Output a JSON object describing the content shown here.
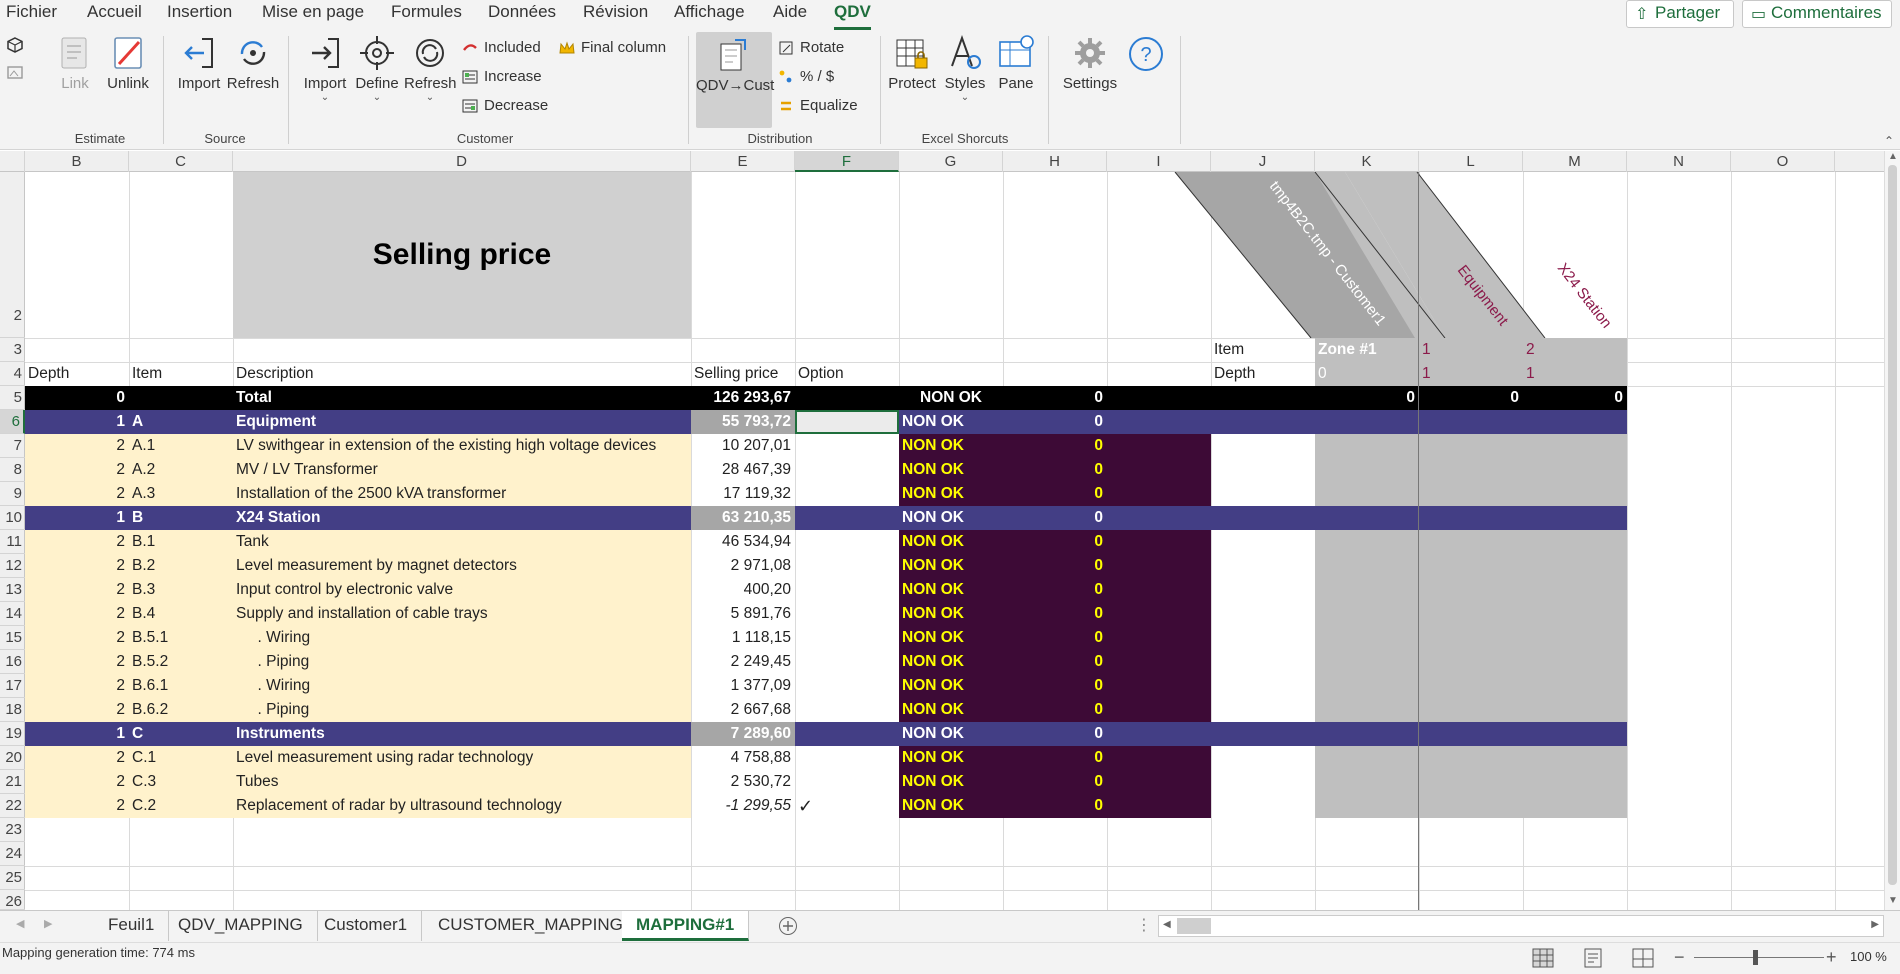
{
  "menu": {
    "items": [
      "Fichier",
      "Accueil",
      "Insertion",
      "Mise en page",
      "Formules",
      "Données",
      "Révision",
      "Affichage",
      "Aide",
      "QDV"
    ],
    "active": "QDV",
    "share_label": "Partager",
    "comments_label": "Commentaires"
  },
  "ribbon": {
    "estimate": {
      "label": "Estimate",
      "link": "Link",
      "unlink": "Unlink"
    },
    "source": {
      "label": "Source",
      "import": "Import",
      "refresh": "Refresh"
    },
    "customer": {
      "label": "Customer",
      "import": "Import",
      "define": "Define",
      "refresh": "Refresh",
      "included": "Included",
      "increase": "Increase",
      "decrease": "Decrease",
      "final_column": "Final column"
    },
    "distribution": {
      "label": "Distribution",
      "qdv_cust": "QDV→Cust",
      "rotate": "Rotate",
      "percent": "% / $",
      "equalize": "Equalize"
    },
    "excel": {
      "label": "Excel Shorcuts",
      "protect": "Protect",
      "styles": "Styles",
      "pane": "Pane"
    },
    "settings": {
      "label": "Settings"
    }
  },
  "columns": [
    "B",
    "C",
    "D",
    "E",
    "F",
    "G",
    "H",
    "I",
    "J",
    "K",
    "L",
    "M",
    "N",
    "O"
  ],
  "selected_column": "F",
  "rows_numbers": [
    "2",
    "3",
    "4",
    "5",
    "6",
    "7",
    "8",
    "9",
    "10",
    "11",
    "12",
    "13",
    "14",
    "15",
    "16",
    "17",
    "18",
    "19",
    "20",
    "21",
    "22",
    "23",
    "24",
    "25",
    "26"
  ],
  "selected_row": "6",
  "sheet": {
    "title": "Selling price",
    "rotated_headers": [
      "tmp4B2C.tmp - Customer1",
      "Equipment",
      "X24 Station"
    ],
    "row3": {
      "item_label": "Item",
      "zone": "Zone #1",
      "k1": "1",
      "k2": "2"
    },
    "row4": {
      "depth": "Depth",
      "item": "Item",
      "description": "Description",
      "selling_price": "Selling price",
      "option": "Option",
      "depth_label": "Depth",
      "d0": "0",
      "d1": "1",
      "d2": "1"
    },
    "total": {
      "depth": "0",
      "description": "Total",
      "price": "126 293,67",
      "status": "NON OK",
      "value": "0",
      "k": "0",
      "l": "0",
      "m": "0"
    },
    "lines": [
      {
        "depth": "1",
        "item": "A",
        "desc": "Equipment",
        "price": "55 793,72",
        "option": "",
        "status": "NON OK",
        "val": "0",
        "kind": "group"
      },
      {
        "depth": "2",
        "item": "A.1",
        "desc": "LV swithgear in extension of the existing high voltage devices",
        "price": "10 207,01",
        "option": "",
        "status": "NON OK",
        "val": "0",
        "kind": "line"
      },
      {
        "depth": "2",
        "item": "A.2",
        "desc": "MV / LV Transformer",
        "price": "28 467,39",
        "option": "",
        "status": "NON OK",
        "val": "0",
        "kind": "line"
      },
      {
        "depth": "2",
        "item": "A.3",
        "desc": "Installation of the 2500 kVA transformer",
        "price": "17 119,32",
        "option": "",
        "status": "NON OK",
        "val": "0",
        "kind": "line"
      },
      {
        "depth": "1",
        "item": "B",
        "desc": "X24 Station",
        "price": "63 210,35",
        "option": "",
        "status": "NON OK",
        "val": "0",
        "kind": "group"
      },
      {
        "depth": "2",
        "item": "B.1",
        "desc": "Tank",
        "price": "46 534,94",
        "option": "",
        "status": "NON OK",
        "val": "0",
        "kind": "line"
      },
      {
        "depth": "2",
        "item": "B.2",
        "desc": "Level measurement by magnet detectors",
        "price": "2 971,08",
        "option": "",
        "status": "NON OK",
        "val": "0",
        "kind": "line"
      },
      {
        "depth": "2",
        "item": "B.3",
        "desc": "Input control by electronic valve",
        "price": "400,20",
        "option": "",
        "status": "NON OK",
        "val": "0",
        "kind": "line"
      },
      {
        "depth": "2",
        "item": "B.4",
        "desc": "Supply and installation of cable trays",
        "price": "5 891,76",
        "option": "",
        "status": "NON OK",
        "val": "0",
        "kind": "line"
      },
      {
        "depth": "2",
        "item": "B.5.1",
        "desc": "     . Wiring",
        "price": "1 118,15",
        "option": "",
        "status": "NON OK",
        "val": "0",
        "kind": "line"
      },
      {
        "depth": "2",
        "item": "B.5.2",
        "desc": "     . Piping",
        "price": "2 249,45",
        "option": "",
        "status": "NON OK",
        "val": "0",
        "kind": "line"
      },
      {
        "depth": "2",
        "item": "B.6.1",
        "desc": "     . Wiring",
        "price": "1 377,09",
        "option": "",
        "status": "NON OK",
        "val": "0",
        "kind": "line"
      },
      {
        "depth": "2",
        "item": "B.6.2",
        "desc": "     . Piping",
        "price": "2 667,68",
        "option": "",
        "status": "NON OK",
        "val": "0",
        "kind": "line"
      },
      {
        "depth": "1",
        "item": "C",
        "desc": "Instruments",
        "price": "7 289,60",
        "option": "",
        "status": "NON OK",
        "val": "0",
        "kind": "group"
      },
      {
        "depth": "2",
        "item": "C.1",
        "desc": "Level measurement using radar technology",
        "price": "4 758,88",
        "option": "",
        "status": "NON OK",
        "val": "0",
        "kind": "line"
      },
      {
        "depth": "2",
        "item": "C.3",
        "desc": "Tubes",
        "price": "2 530,72",
        "option": "",
        "status": "NON OK",
        "val": "0",
        "kind": "line"
      },
      {
        "depth": "2",
        "item": "C.2",
        "desc": "Replacement of radar by ultrasound technology",
        "price": "-1 299,55",
        "option": "✓",
        "status": "NON OK",
        "val": "0",
        "kind": "option"
      }
    ]
  },
  "tabs": [
    "Feuil1",
    "QDV_MAPPING",
    "Customer1",
    "CUSTOMER_MAPPING",
    "MAPPING#1"
  ],
  "active_tab": "MAPPING#1",
  "status": {
    "message": "Mapping generation time: 774 ms",
    "zoom": "100 %"
  },
  "colors": {
    "accent": "#1e6e3c",
    "group": "#433e85",
    "cream": "#fff2cc",
    "status_bg": "#3d0a36",
    "status_fg": "#ffff00",
    "gray": "#bfbfbf"
  }
}
